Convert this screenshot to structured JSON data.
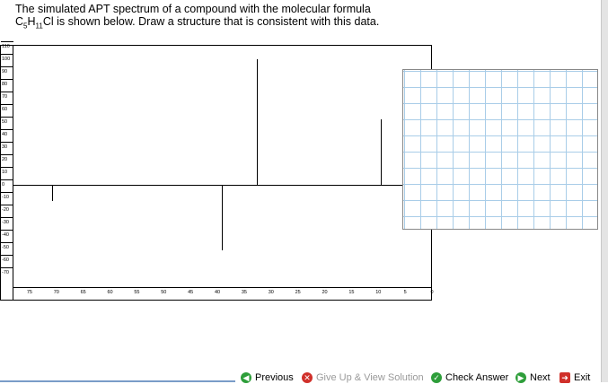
{
  "question": {
    "line1": "The simulated APT spectrum of a compound with the molecular formula",
    "formula_c": "C",
    "formula_c_sub": "5",
    "formula_h": "H",
    "formula_h_sub": "11",
    "formula_rest": "Cl is shown below. Draw a structure that is consistent with this data."
  },
  "chart_data": {
    "type": "bar",
    "title": "",
    "xlabel": "",
    "ylabel": "",
    "xlim": [
      78,
      0
    ],
    "ylim": [
      -75,
      113
    ],
    "x_ticks": [
      75,
      70,
      65,
      60,
      55,
      50,
      45,
      40,
      35,
      30,
      25,
      20,
      15,
      10,
      5,
      0
    ],
    "y_ticks": [
      110,
      100,
      90,
      80,
      70,
      60,
      50,
      40,
      30,
      20,
      10,
      0,
      -10,
      -20,
      -30,
      -40,
      -50,
      -60,
      -70
    ],
    "peaks": [
      {
        "x": 70.8,
        "y": -13
      },
      {
        "x": 39.2,
        "y": -52
      },
      {
        "x": 32.6,
        "y": 100
      },
      {
        "x": 9.6,
        "y": 52
      }
    ]
  },
  "buttons": {
    "previous": "Previous",
    "give_up": "Give Up & View Solution",
    "check": "Check Answer",
    "next": "Next",
    "exit": "Exit"
  },
  "colors": {
    "grid_line": "#a9cde8",
    "green_icon": "#2e9e3a",
    "red_icon": "#d0302a"
  },
  "icons": {
    "previous": "green-arrow-left-icon",
    "give_up": "red-x-icon",
    "check": "green-check-icon",
    "next": "green-arrow-right-icon",
    "exit": "red-exit-icon"
  }
}
